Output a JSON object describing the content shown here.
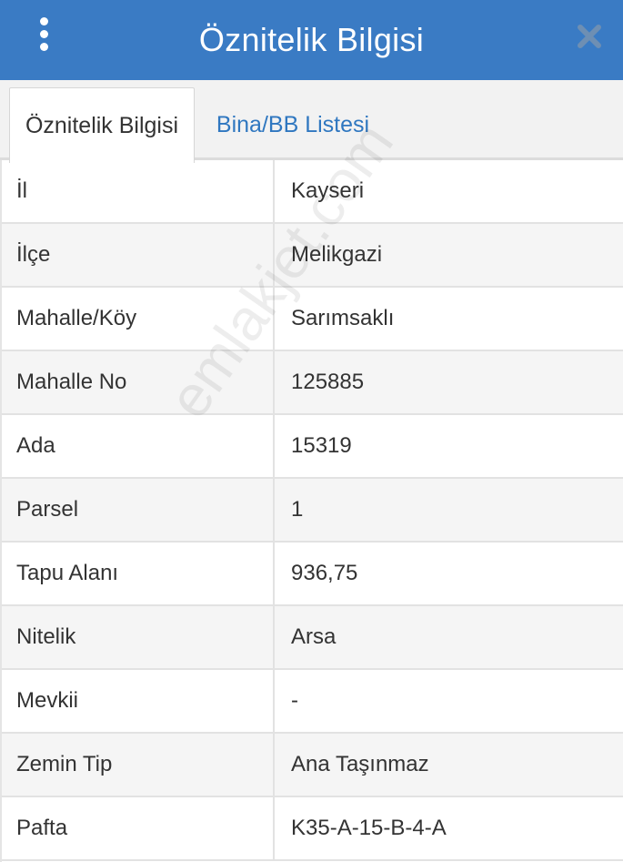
{
  "header": {
    "title": "Öznitelik Bilgisi",
    "menu_icon": "kebab-menu-icon",
    "close_icon": "close-icon",
    "bg_color": "#3a7bc4"
  },
  "tabs": [
    {
      "label": "Öznitelik Bilgisi",
      "active": true
    },
    {
      "label": "Bina/BB Listesi",
      "active": false,
      "color": "#2f77c0"
    }
  ],
  "rows": [
    {
      "label": "İl",
      "value": "Kayseri"
    },
    {
      "label": "İlçe",
      "value": "Melikgazi"
    },
    {
      "label": "Mahalle/Köy",
      "value": "Sarımsaklı"
    },
    {
      "label": "Mahalle No",
      "value": "125885"
    },
    {
      "label": "Ada",
      "value": "15319"
    },
    {
      "label": "Parsel",
      "value": "1"
    },
    {
      "label": "Tapu Alanı",
      "value": "936,75"
    },
    {
      "label": "Nitelik",
      "value": "Arsa"
    },
    {
      "label": "Mevkii",
      "value": "-"
    },
    {
      "label": "Zemin Tip",
      "value": "Ana Taşınmaz"
    },
    {
      "label": "Pafta",
      "value": "K35-A-15-B-4-A"
    }
  ],
  "watermark": "emlakjet.com"
}
